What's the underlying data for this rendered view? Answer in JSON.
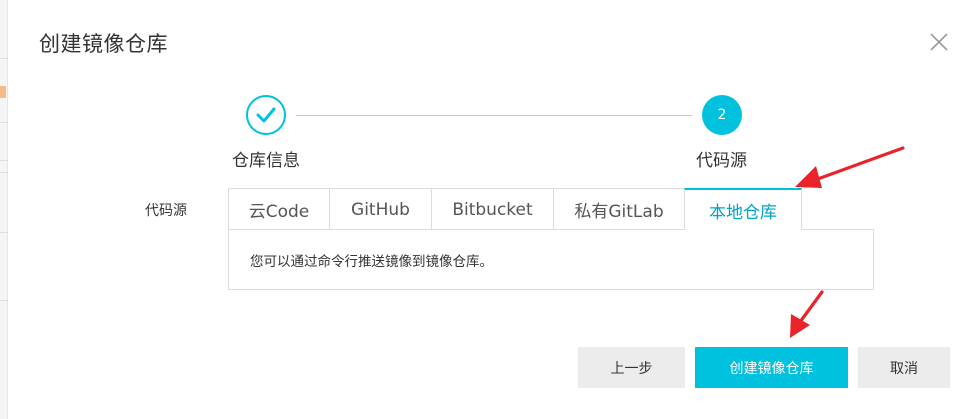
{
  "dialog": {
    "title": "创建镜像仓库"
  },
  "stepper": {
    "steps": [
      {
        "label": "仓库信息",
        "state": "done",
        "icon": "check-icon"
      },
      {
        "label": "代码源",
        "state": "current",
        "number": "2"
      }
    ]
  },
  "form": {
    "source_label": "代码源",
    "tabs": [
      {
        "label": "云Code",
        "active": false
      },
      {
        "label": "GitHub",
        "active": false
      },
      {
        "label": "Bitbucket",
        "active": false
      },
      {
        "label": "私有GitLab",
        "active": false
      },
      {
        "label": "本地仓库",
        "active": true
      }
    ],
    "panel_text": "您可以通过命令行推送镜像到镜像仓库。"
  },
  "footer": {
    "prev_label": "上一步",
    "create_label": "创建镜像仓库",
    "cancel_label": "取消"
  },
  "colors": {
    "accent": "#00c1de",
    "annotation_arrow": "#e8232a",
    "button_gray": "#ececec"
  }
}
